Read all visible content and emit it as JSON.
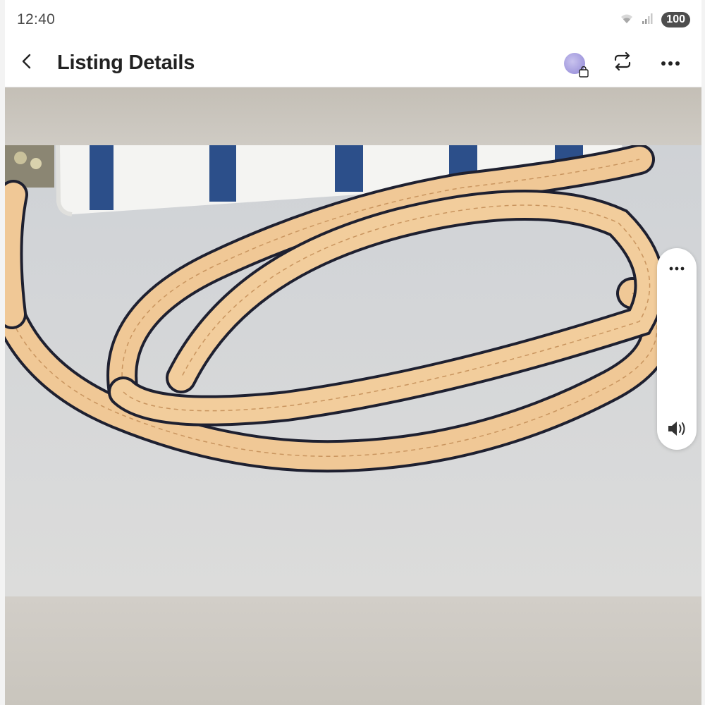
{
  "status_bar": {
    "time": "12:40",
    "battery": "100",
    "icons": [
      "wifi-icon",
      "signal-icon",
      "battery-icon"
    ]
  },
  "app_bar": {
    "title": "Listing Details",
    "back_icon": "back-arrow-icon",
    "actions": [
      "closet-avatar-icon",
      "repost-icon",
      "more-options-icon"
    ]
  },
  "photo": {
    "description_icon": "listing-photo"
  },
  "side_controls": {
    "icons": [
      "more-options-icon",
      "volume-icon"
    ]
  },
  "colors": {
    "title": "#222222",
    "background": "#ffffff",
    "strap_tan": "#f0c896",
    "bag_navy": "#2c4f8a"
  }
}
